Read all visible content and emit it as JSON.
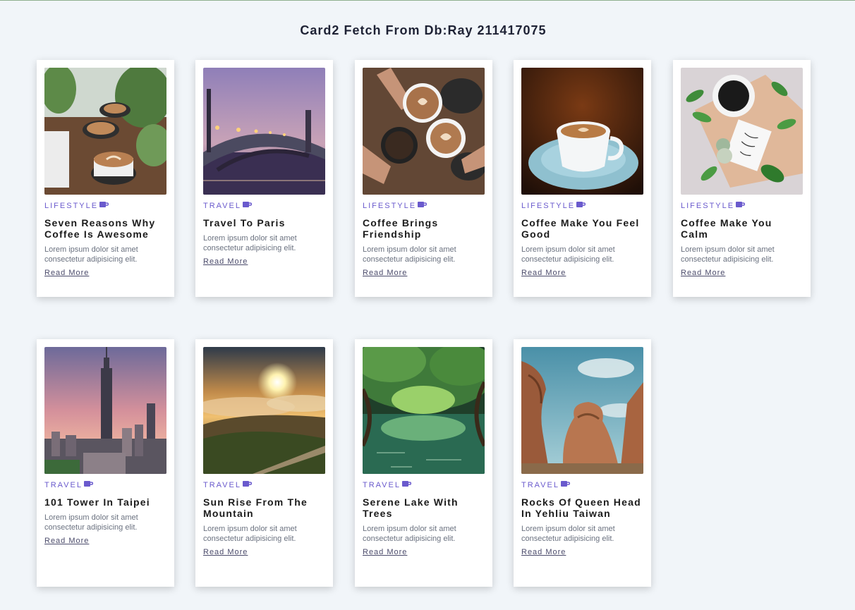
{
  "page": {
    "title": "Card2 Fetch From Db:Ray 211417075"
  },
  "colors": {
    "background": "#f1f5f9",
    "category": "#6a5acd",
    "card": "#ffffff"
  },
  "cards": [
    {
      "category": "LIFESTYLE",
      "title": "Seven Reasons Why Coffee Is Awesome",
      "description": "Lorem ipsum dolor sit amet consectetur adipisicing elit.",
      "link": "Read More",
      "image": "coffee-cups-with-plants"
    },
    {
      "category": "TRAVEL",
      "title": "Travel To Paris",
      "description": "Lorem ipsum dolor sit amet consectetur adipisicing elit.",
      "link": "Read More",
      "image": "paris-bridge-at-dusk"
    },
    {
      "category": "LIFESTYLE",
      "title": "Coffee Brings Friendship",
      "description": "Lorem ipsum dolor sit amet consectetur adipisicing elit.",
      "link": "Read More",
      "image": "hands-holding-coffee-cups"
    },
    {
      "category": "LIFESTYLE",
      "title": "Coffee Make You Feel Good",
      "description": "Lorem ipsum dolor sit amet consectetur adipisicing elit.",
      "link": "Read More",
      "image": "coffee-cup-on-saucer"
    },
    {
      "category": "LIFESTYLE",
      "title": "Coffee Make You Calm",
      "description": "Lorem ipsum dolor sit amet consectetur adipisicing elit.",
      "link": "Read More",
      "image": "coffee-flatlay-with-leaves"
    },
    {
      "category": "TRAVEL",
      "title": "101 Tower In Taipei",
      "description": "Lorem ipsum dolor sit amet consectetur adipisicing elit.",
      "link": "Read More",
      "image": "taipei-101-skyline"
    },
    {
      "category": "TRAVEL",
      "title": "Sun Rise From The Mountain",
      "description": "Lorem ipsum dolor sit amet consectetur adipisicing elit.",
      "link": "Read More",
      "image": "sunrise-over-clouds"
    },
    {
      "category": "TRAVEL",
      "title": "Serene Lake With Trees",
      "description": "Lorem ipsum dolor sit amet consectetur adipisicing elit.",
      "link": "Read More",
      "image": "green-tree-tunnel-lake"
    },
    {
      "category": "TRAVEL",
      "title": "Rocks Of Queen Head In Yehliu Taiwan",
      "description": "Lorem ipsum dolor sit amet consectetur adipisicing elit.",
      "link": "Read More",
      "image": "queen-head-rock-formation"
    }
  ]
}
